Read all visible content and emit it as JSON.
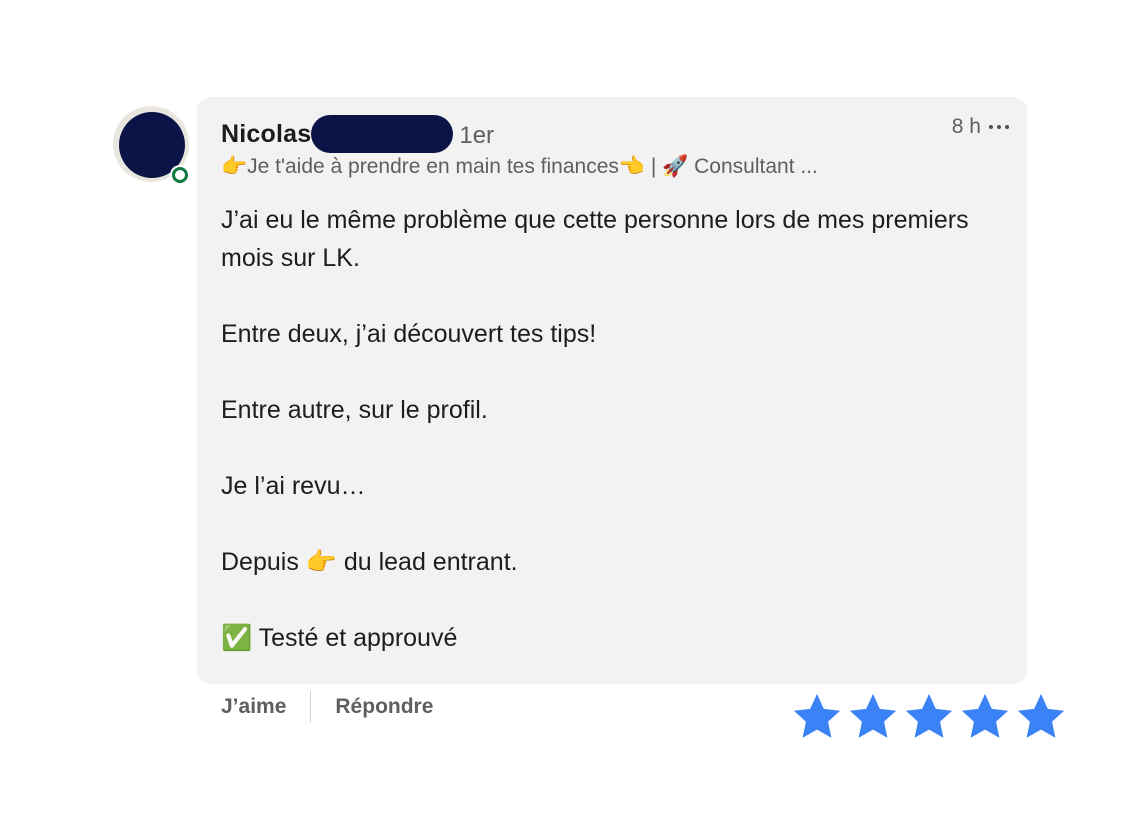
{
  "comment": {
    "author_name": "Nicolas",
    "connection_degree": "1er",
    "time": "8 h",
    "headline": "👉Je t'aide à prendre en main tes finances👈 | 🚀 Consultant ...",
    "body": [
      "J’ai eu le même problème que cette personne lors de mes premiers mois sur LK.",
      "Entre deux, j’ai découvert tes tips!",
      "Entre autre, sur le profil.",
      "Je l’ai revu…",
      "Depuis 👉 du lead entrant.",
      "✅ Testé et approuvé"
    ]
  },
  "actions": {
    "like_label": "J’aime",
    "reply_label": "Répondre"
  },
  "rating": {
    "stars": 5,
    "max": 5,
    "color": "#3b82f6"
  },
  "icons": {
    "more": "more-horizontal-icon",
    "star": "star-icon"
  },
  "colors": {
    "bubble_bg": "#f2f2f2",
    "avatar_redaction": "#0b1447",
    "online_status": "#0f7a3f"
  }
}
